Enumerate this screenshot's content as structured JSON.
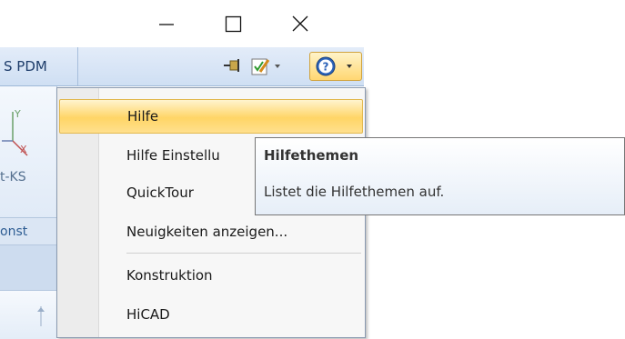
{
  "window": {
    "minimize_icon": "minimize-icon",
    "maximize_icon": "maximize-icon",
    "close_icon": "close-icon"
  },
  "ribbon": {
    "tab_label": "S PDM",
    "quick_access": [
      "pin-icon",
      "edit-checklist-icon",
      "help-icon"
    ],
    "ks_label": "t-KS",
    "group_label": "onst"
  },
  "menu": {
    "items": [
      {
        "label": "Hilfe",
        "highlighted": true
      },
      {
        "label": "Hilfe Einstellu",
        "highlighted": false
      },
      {
        "label": "QuickTour",
        "highlighted": false
      },
      {
        "label": "Neuigkeiten anzeigen...",
        "highlighted": false
      },
      {
        "label": "Konstruktion",
        "highlighted": false
      },
      {
        "label": "HiCAD",
        "highlighted": false
      }
    ]
  },
  "tooltip": {
    "title": "Hilfethemen",
    "description": "Listet die Hilfethemen auf."
  },
  "colors": {
    "highlight": "#ffd566",
    "ribbon_blue": "#cfdff3",
    "help_blue": "#2b62b8"
  }
}
